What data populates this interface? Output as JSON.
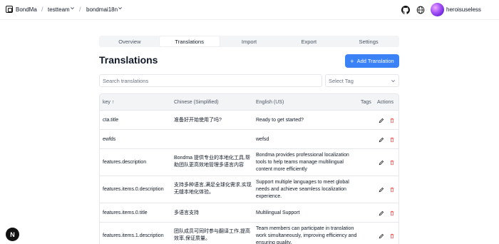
{
  "breadcrumb": {
    "items": [
      {
        "label": "BondMa"
      },
      {
        "label": "testteam"
      },
      {
        "label": "bondmai18n"
      }
    ],
    "separator": "/"
  },
  "header": {
    "username": "heroisuseless"
  },
  "tabs": [
    {
      "label": "Overview",
      "active": false
    },
    {
      "label": "Translations",
      "active": true
    },
    {
      "label": "Import",
      "active": false
    },
    {
      "label": "Export",
      "active": false
    },
    {
      "label": "Settings",
      "active": false
    }
  ],
  "page": {
    "title": "Translations",
    "add_button": "Add Translation"
  },
  "filters": {
    "search_placeholder": "Search translations",
    "tag_select": "Select Tag"
  },
  "table": {
    "columns": {
      "key": "key ↑",
      "zh": "Chinese (Simplified)",
      "en": "English (US)",
      "tags": "Tags",
      "actions": "Actions"
    },
    "rows": [
      {
        "key": "cta.title",
        "zh": "准备好开始使用了吗?",
        "en": "Ready to get started?"
      },
      {
        "key": "ewfds",
        "zh": "",
        "en": "wefsd"
      },
      {
        "key": "features.description",
        "zh": "Bondma 提供专业的本地化工具,帮助团队更高效地管理多语言内容",
        "en": "Bondma provides professional localization tools to help teams manage multilingual content more efficiently"
      },
      {
        "key": "features.items.0.description",
        "zh": "支持多种语言,满足全球化需求,实现无缝本地化体验。",
        "en": "Support multiple languages to meet global needs and achieve seamless localization experience."
      },
      {
        "key": "features.items.0.title",
        "zh": "多语言支持",
        "en": "Multilingual Support"
      },
      {
        "key": "features.items.1.description",
        "zh": "团队成员可同时参与翻译工作,提高效率,保证质量。",
        "en": "Team members can participate in translation work simultaneously, improving efficiency and ensuring quality."
      }
    ]
  },
  "colors": {
    "primary": "#3b82f6",
    "delete": "#ef4444"
  },
  "icons": {
    "edit": "pencil-icon",
    "delete": "trash-icon",
    "github": "github-icon",
    "language": "globe-icon"
  },
  "badge": {
    "label": "N"
  }
}
